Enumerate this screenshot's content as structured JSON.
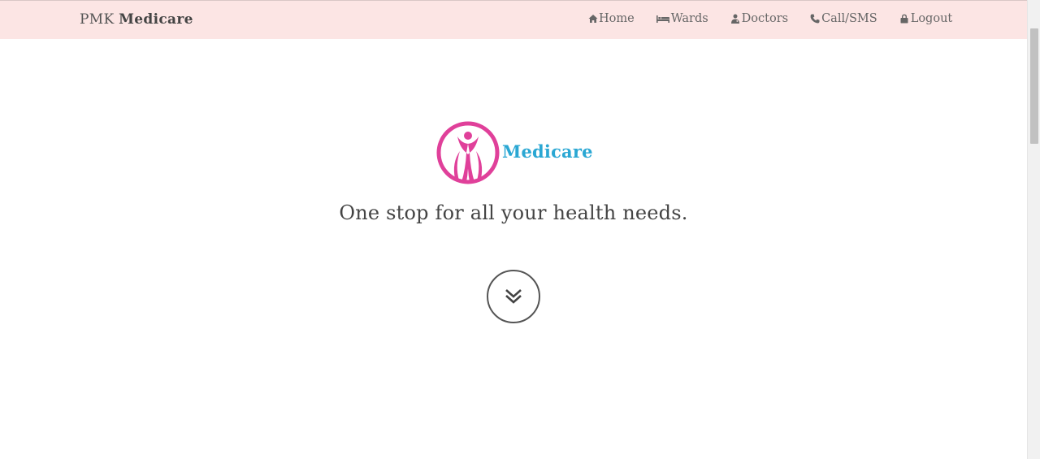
{
  "navbar": {
    "brand_prefix": "PMK",
    "brand_name": "Medicare",
    "items": [
      {
        "label": "Home",
        "icon": "home-icon"
      },
      {
        "label": "Wards",
        "icon": "bed-icon"
      },
      {
        "label": "Doctors",
        "icon": "doctor-icon"
      },
      {
        "label": "Call/SMS",
        "icon": "phone-icon"
      },
      {
        "label": "Logout",
        "icon": "lock-icon"
      }
    ]
  },
  "hero": {
    "logo_text": "Medicare",
    "tagline": "One stop for all your health needs.",
    "scroll_icon": "double-chevron-down-icon"
  },
  "colors": {
    "navbar_bg": "#fce5e4",
    "logo_pink": "#e0409a",
    "logo_blue": "#2aa7d3"
  }
}
